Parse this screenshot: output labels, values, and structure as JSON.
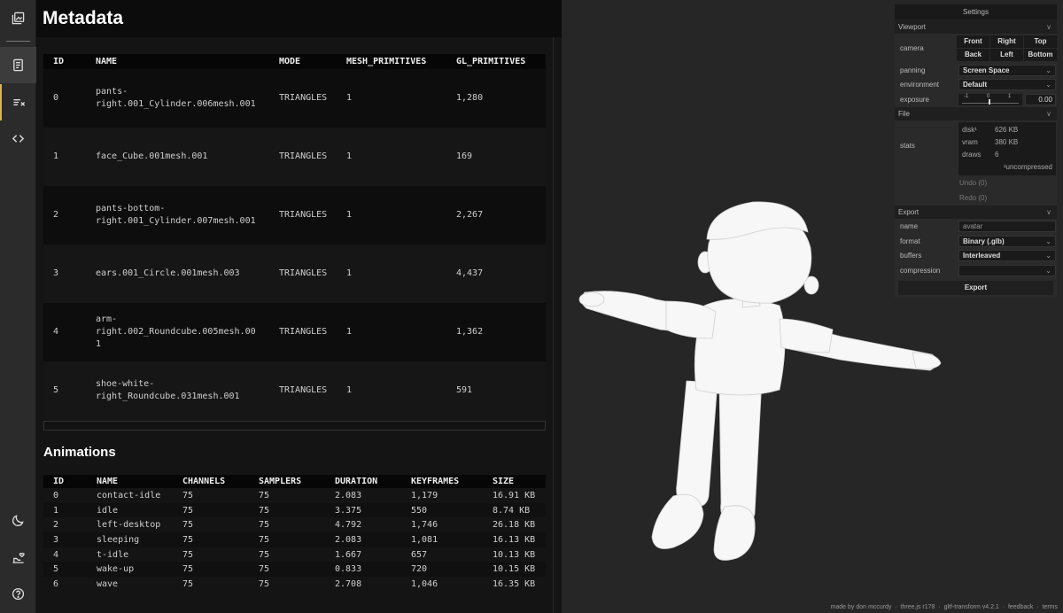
{
  "rail": {
    "top_icons": [
      "gallery-icon",
      "document-icon",
      "filter-list-icon",
      "code-icon"
    ],
    "bottom_icons": [
      "moon-icon",
      "sponsor-icon",
      "help-icon"
    ]
  },
  "metadata": {
    "title": "Metadata",
    "meshes": {
      "headers": [
        "ID",
        "NAME",
        "MODE",
        "MESH_PRIMITIVES",
        "GL_PRIMITIVES"
      ],
      "rows": [
        {
          "id": "0",
          "name": "pants-right.001_Cylinder.006mesh.001",
          "mode": "TRIANGLES",
          "mesh_primitives": "1",
          "gl_primitives": "1,280"
        },
        {
          "id": "1",
          "name": "face_Cube.001mesh.001",
          "mode": "TRIANGLES",
          "mesh_primitives": "1",
          "gl_primitives": "169"
        },
        {
          "id": "2",
          "name": "pants-bottom-right.001_Cylinder.007mesh.001",
          "mode": "TRIANGLES",
          "mesh_primitives": "1",
          "gl_primitives": "2,267"
        },
        {
          "id": "3",
          "name": "ears.001_Circle.001mesh.003",
          "mode": "TRIANGLES",
          "mesh_primitives": "1",
          "gl_primitives": "4,437"
        },
        {
          "id": "4",
          "name": "arm-right.002_Roundcube.005mesh.001",
          "mode": "TRIANGLES",
          "mesh_primitives": "1",
          "gl_primitives": "1,362"
        },
        {
          "id": "5",
          "name": "shoe-white-right_Roundcube.031mesh.001",
          "mode": "TRIANGLES",
          "mesh_primitives": "1",
          "gl_primitives": "591"
        }
      ]
    },
    "animations": {
      "title": "Animations",
      "headers": [
        "ID",
        "NAME",
        "CHANNELS",
        "SAMPLERS",
        "DURATION",
        "KEYFRAMES",
        "SIZE"
      ],
      "rows": [
        {
          "id": "0",
          "name": "contact-idle",
          "channels": "75",
          "samplers": "75",
          "duration": "2.083",
          "keyframes": "1,179",
          "size": "16.91 KB"
        },
        {
          "id": "1",
          "name": "idle",
          "channels": "75",
          "samplers": "75",
          "duration": "3.375",
          "keyframes": "550",
          "size": "8.74 KB"
        },
        {
          "id": "2",
          "name": "left-desktop",
          "channels": "75",
          "samplers": "75",
          "duration": "4.792",
          "keyframes": "1,746",
          "size": "26.18 KB"
        },
        {
          "id": "3",
          "name": "sleeping",
          "channels": "75",
          "samplers": "75",
          "duration": "2.083",
          "keyframes": "1,081",
          "size": "16.13 KB"
        },
        {
          "id": "4",
          "name": "t-idle",
          "channels": "75",
          "samplers": "75",
          "duration": "1.667",
          "keyframes": "657",
          "size": "10.13 KB"
        },
        {
          "id": "5",
          "name": "wake-up",
          "channels": "75",
          "samplers": "75",
          "duration": "0.833",
          "keyframes": "720",
          "size": "10.15 KB"
        },
        {
          "id": "6",
          "name": "wave",
          "channels": "75",
          "samplers": "75",
          "duration": "2.708",
          "keyframes": "1,046",
          "size": "16.35 KB"
        }
      ]
    }
  },
  "settings": {
    "title": "Settings",
    "viewport": {
      "label": "Viewport",
      "camera_label": "camera",
      "camera_buttons": [
        "Front",
        "Right",
        "Top",
        "Back",
        "Left",
        "Bottom"
      ],
      "panning_label": "panning",
      "panning_value": "Screen Space",
      "environment_label": "environment",
      "environment_value": "Default",
      "exposure_label": "exposure",
      "exposure_ticks": [
        "-1",
        "0",
        "1"
      ],
      "exposure_value": "0.00"
    },
    "file": {
      "label": "File",
      "stats_label": "stats",
      "disk_label": "disk¹",
      "disk_value": "626 KB",
      "vram_label": "vram",
      "vram_value": "380 KB",
      "draws_label": "draws",
      "draws_value": "6",
      "note": "¹uncompressed",
      "undo": "Undo (0)",
      "redo": "Redo (0)"
    },
    "export": {
      "label": "Export",
      "name_label": "name",
      "name_placeholder": "avatar",
      "format_label": "format",
      "format_value": "Binary (.glb)",
      "buffers_label": "buffers",
      "buffers_value": "Interleaved",
      "compression_label": "compression",
      "compression_value": "",
      "export_button": "Export"
    }
  },
  "footer": {
    "credit": "made by don mccurdy",
    "three": "three.js r178",
    "gltf": "gltf-transform v4.2.1",
    "feedback": "feedback",
    "terms": "terms",
    "sep": "·"
  }
}
